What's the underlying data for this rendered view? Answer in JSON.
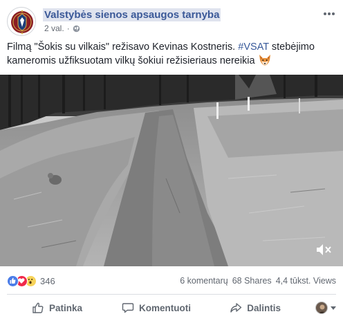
{
  "post": {
    "page_name": "Valstybės sienos apsaugos tarnyba",
    "time_ago": "2 val.",
    "separator": "·",
    "text_plain_1": "Filmą \"Šokis su vilkais\" režisavo Kevinas Kostneris. ",
    "hashtag": "#VSAT",
    "text_plain_2": " stebėjimo kameromis užfiksuotam vilkų šokiui režisieriaus nereikia",
    "emoji_icon": "fox-face-icon"
  },
  "stats": {
    "reaction_icons": [
      "like-icon",
      "love-icon",
      "wow-icon"
    ],
    "reaction_count": "346",
    "comments": "6 komentarų",
    "shares": "68 Shares",
    "views": "4,4 tūkst. Views"
  },
  "actions": {
    "like_label": "Patinka",
    "comment_label": "Komentuoti",
    "share_label": "Dalintis"
  },
  "colors": {
    "link_blue": "#3b5998",
    "hashtag_blue": "#365899",
    "like_blue": "#4a7ce8",
    "love_red": "#f0284a",
    "wow_yellow": "#f7d35a",
    "muted_text": "#616770"
  }
}
